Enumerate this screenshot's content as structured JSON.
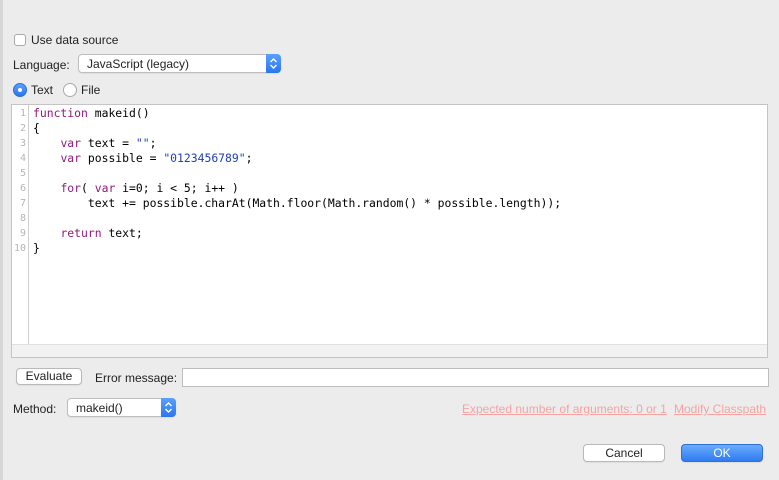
{
  "options": {
    "use_data_source_label": "Use data source",
    "use_data_source_checked": false
  },
  "language": {
    "label": "Language:",
    "selected": "JavaScript (legacy)"
  },
  "source_mode": {
    "text_label": "Text",
    "file_label": "File",
    "selected": "Text"
  },
  "editor": {
    "lines": [
      {
        "num": "1",
        "parts": [
          {
            "t": "kw",
            "v": "function"
          },
          {
            "t": "p",
            "v": " makeid()"
          }
        ]
      },
      {
        "num": "2",
        "parts": [
          {
            "t": "p",
            "v": "{"
          }
        ]
      },
      {
        "num": "3",
        "parts": [
          {
            "t": "p",
            "v": "    "
          },
          {
            "t": "kw",
            "v": "var"
          },
          {
            "t": "p",
            "v": " text = "
          },
          {
            "t": "str",
            "v": "\"\""
          },
          {
            "t": "p",
            "v": ";"
          }
        ]
      },
      {
        "num": "4",
        "parts": [
          {
            "t": "p",
            "v": "    "
          },
          {
            "t": "kw",
            "v": "var"
          },
          {
            "t": "p",
            "v": " possible = "
          },
          {
            "t": "str",
            "v": "\"0123456789\""
          },
          {
            "t": "p",
            "v": ";"
          }
        ]
      },
      {
        "num": "5",
        "parts": []
      },
      {
        "num": "6",
        "parts": [
          {
            "t": "p",
            "v": "    "
          },
          {
            "t": "kw",
            "v": "for"
          },
          {
            "t": "p",
            "v": "( "
          },
          {
            "t": "kw",
            "v": "var"
          },
          {
            "t": "p",
            "v": " i=0; i < 5; i++ )"
          }
        ]
      },
      {
        "num": "7",
        "parts": [
          {
            "t": "p",
            "v": "        text += possible.charAt(Math.floor(Math.random() * possible.length));"
          }
        ]
      },
      {
        "num": "8",
        "parts": []
      },
      {
        "num": "9",
        "parts": [
          {
            "t": "p",
            "v": "    "
          },
          {
            "t": "kw",
            "v": "return"
          },
          {
            "t": "p",
            "v": " text;"
          }
        ]
      },
      {
        "num": "10",
        "parts": [
          {
            "t": "p",
            "v": "}"
          }
        ]
      }
    ]
  },
  "evaluate": {
    "button_label": "Evaluate",
    "error_label": "Error message:",
    "error_value": ""
  },
  "method": {
    "label": "Method:",
    "selected": "makeid()",
    "hint": "Expected number of arguments: 0 or 1",
    "modify_classpath": "Modify Classpath"
  },
  "footer": {
    "cancel_label": "Cancel",
    "ok_label": "OK"
  },
  "colors": {
    "accent": "#2f7cf0",
    "keyword": "#8e1a7d",
    "string": "#1f3fb8",
    "warning_link": "#f5a3a3"
  }
}
